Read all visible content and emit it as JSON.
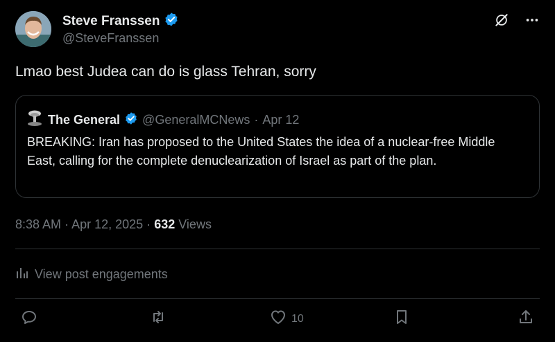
{
  "author": {
    "name": "Steve Franssen",
    "handle": "@SteveFranssen"
  },
  "post": {
    "text": "Lmao best Judea can do is glass Tehran, sorry"
  },
  "quote": {
    "name": "The General",
    "handle": "@GeneralMCNews",
    "separator": "·",
    "date": "Apr 12",
    "text": "BREAKING: Iran has proposed to the United States the idea of a nuclear-free Middle East, calling for the complete denuclearization of Israel as part of the plan."
  },
  "meta": {
    "time": "8:38 AM",
    "sep1": "·",
    "date": "Apr 12, 2025",
    "sep2": "·",
    "views_count": "632",
    "views_label": "Views"
  },
  "engagements": {
    "label": "View post engagements"
  },
  "actions": {
    "like_count": "10"
  },
  "colors": {
    "background": "#000000",
    "text": "#e7e9ea",
    "secondary": "#71767b",
    "verified": "#1d9bf0",
    "border": "#2f3336"
  },
  "icons": [
    "grok-icon",
    "more-icon",
    "verified-badge-icon",
    "analytics-icon",
    "reply-icon",
    "repost-icon",
    "like-icon",
    "bookmark-icon",
    "share-icon"
  ]
}
